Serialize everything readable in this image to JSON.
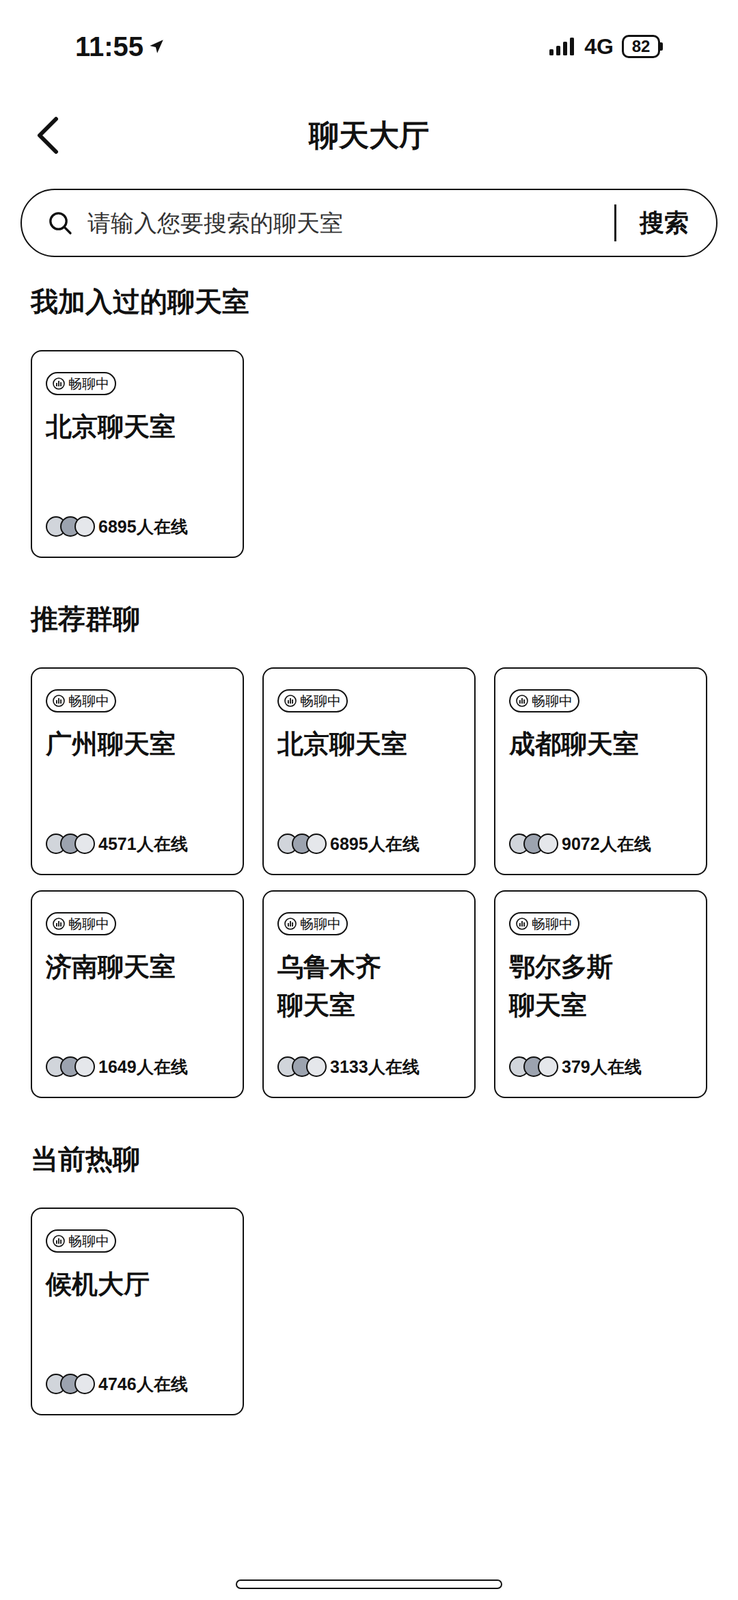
{
  "status_bar": {
    "time": "11:55",
    "network": "4G",
    "battery": "82"
  },
  "window": {
    "title": "聊天大厅"
  },
  "search": {
    "placeholder": "请输入您要搜索的聊天室",
    "button": "搜索"
  },
  "sections": [
    {
      "title": "我加入过的聊天室",
      "rooms": [
        {
          "title": "北京聊天室",
          "badge": "畅聊中",
          "online": "6895人在线"
        }
      ]
    },
    {
      "title": "推荐群聊",
      "rooms": [
        {
          "title": "广州聊天室",
          "badge": "畅聊中",
          "online": "4571人在线"
        },
        {
          "title": "北京聊天室",
          "badge": "畅聊中",
          "online": "6895人在线"
        },
        {
          "title": "成都聊天室",
          "badge": "畅聊中",
          "online": "9072人在线"
        },
        {
          "title": "济南聊天室",
          "badge": "畅聊中",
          "online": "1649人在线"
        },
        {
          "title": "乌鲁木齐\n聊天室",
          "badge": "畅聊中",
          "online": "3133人在线"
        },
        {
          "title": "鄂尔多斯\n聊天室",
          "badge": "畅聊中",
          "online": "379人在线"
        }
      ]
    },
    {
      "title": "当前热聊",
      "rooms": [
        {
          "title": "候机大厅",
          "badge": "畅聊中",
          "online": "4746人在线"
        }
      ]
    }
  ]
}
